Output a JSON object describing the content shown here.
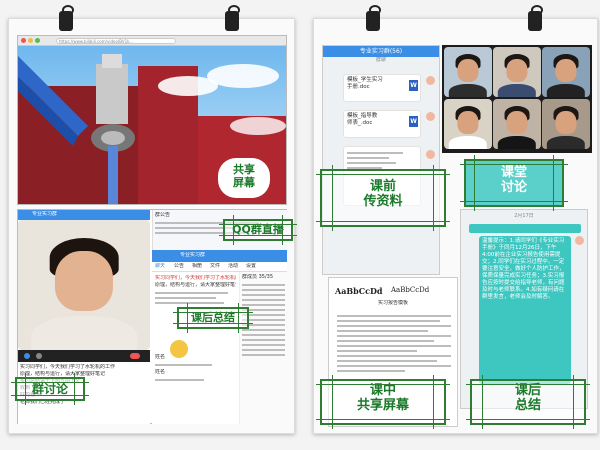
{
  "left_panel": {
    "browser_url": "https://www.bilibili.com/video/BV1k...",
    "labels": {
      "share_screen": "共享\n屏幕",
      "qq_live": "QQ群直播",
      "after_class_summary": "课后总结",
      "group_discussion": "群讨论"
    },
    "chat_window": {
      "title": "专业实习群",
      "tab_chat": "聊天",
      "tab_announce": "公告",
      "tab_album": "相册",
      "tab_file": "文件",
      "tab_activity": "活动",
      "tab_settings": "设置",
      "section_announce": "群公告",
      "section_members": "群成员 35/35",
      "messages": [
        "实习同学们，今天我们学习了水轮机的工作",
        "原理，结构与运行，请大家整理好笔记",
        "姓名",
        "实习总结请于下周五前上交",
        "姓名",
        "收到",
        "姓名",
        "好的老师",
        "老师我们已经完成了"
      ]
    },
    "qq_live_window": {
      "title": "专业实习群",
      "members_header": "群成员 35/35",
      "notice": "群公告"
    }
  },
  "right_panel": {
    "labels": {
      "pre_class_materials": "课前\n传资料",
      "class_discussion": "课堂\n讨论",
      "in_class_share": "课中\n共享屏幕",
      "after_class_summary": "课后\n总结"
    },
    "phone_chat": {
      "title": "专业实习群(56)",
      "subtitle": "群聊",
      "files": [
        {
          "name": "模板_学生实习\n手册.doc",
          "meta": "",
          "icon": "W"
        },
        {
          "name": "模板_指导教\n师表_.doc",
          "meta": "",
          "icon": "W"
        }
      ]
    },
    "phone_announce": {
      "title": "专业实习群(56)",
      "time": "2月17日",
      "message": "温馨提示：1.请同学们《专业实习手册》于同月12月26日，下午4:00前在企业实习报告使用需提交；2.同学们在实习过程中，一定要注意安全，做好个人防护工作，保质保量完成实习任务；3.实习报告应按时提交给指导老师，有问题及时与老师联系。4.如有疑问请在群里发言，老师会及时解答。"
    },
    "doc_preview": {
      "font_sample": "AaBbCcDd",
      "font_sample_2": "AaBbCcDd",
      "title": "实习报告模板"
    }
  },
  "colors": {
    "label_green": "#1b7a2a",
    "hatch_green": "#2e7d32",
    "qq_blue": "#3a8ee6",
    "teal_label_bg": "#3ec7c0"
  }
}
